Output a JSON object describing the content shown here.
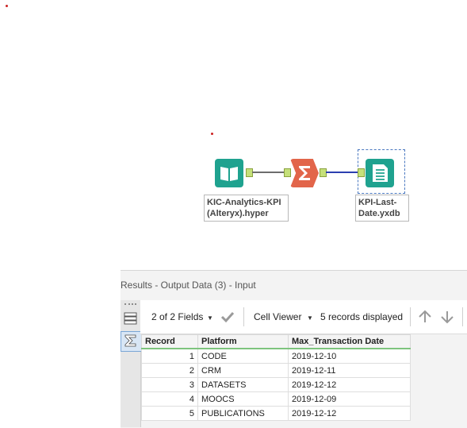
{
  "workflow": {
    "tools": {
      "input_label": "KIC-Analytics-KPI\n(Alteryx).hyper",
      "output_label": "KPI-Last-\nDate.yxdb"
    }
  },
  "results": {
    "title": "Results - Output Data (3) - Input",
    "toolbar": {
      "fields": "2 of 2 Fields",
      "cell_viewer": "Cell Viewer",
      "records": "5 records displayed"
    },
    "columns": [
      "Record",
      "Platform",
      "Max_Transaction Date"
    ],
    "rows": [
      {
        "record": "1",
        "platform": "CODE",
        "date": "2019-12-10"
      },
      {
        "record": "2",
        "platform": "CRM",
        "date": "2019-12-11"
      },
      {
        "record": "3",
        "platform": "DATASETS",
        "date": "2019-12-12"
      },
      {
        "record": "4",
        "platform": "MOOCS",
        "date": "2019-12-09"
      },
      {
        "record": "5",
        "platform": "PUBLICATIONS",
        "date": "2019-12-12"
      }
    ]
  },
  "colors": {
    "input_tool": "#1fa28f",
    "summarize_tool": "#e2654a",
    "output_tool": "#1fa28f",
    "connection_blue": "#2b3fb0"
  },
  "icons": [
    "book-icon",
    "sigma-icon",
    "document-icon",
    "list-view-icon",
    "sigma-tab-icon",
    "checkmark-icon",
    "up-arrow-icon",
    "down-arrow-icon",
    "dropdown-caret-icon"
  ]
}
